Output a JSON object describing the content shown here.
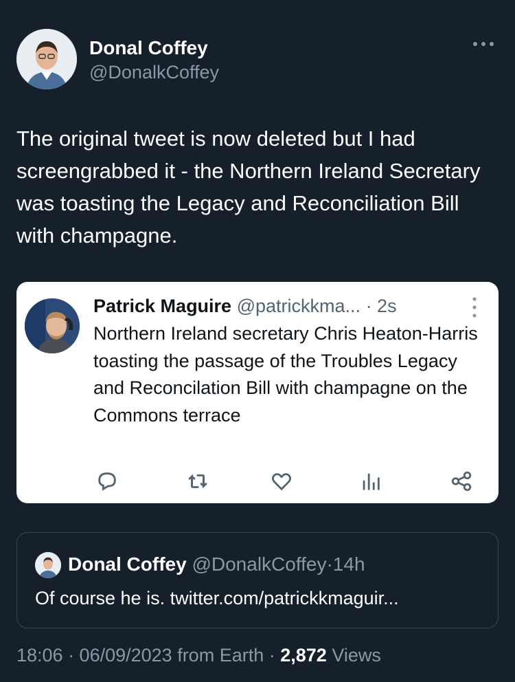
{
  "author": {
    "name": "Donal Coffey",
    "handle": "@DonalkCoffey"
  },
  "tweet": {
    "text": "The original tweet is now deleted but I had screengrabbed it - the Northern Ireland Secretary was toasting the Legacy and Reconciliation Bill with champagne."
  },
  "embedded": {
    "name": "Patrick Maguire",
    "handle": "@patrickkma...",
    "time": "· 2s",
    "text": "Northern Ireland secretary Chris Heaton-Harris toasting the passage of the Troubles Legacy and Reconcilation Bill with champagne on the Commons terrace",
    "actions": [
      "reply-icon",
      "retweet-icon",
      "like-icon",
      "views-icon",
      "share-icon"
    ]
  },
  "quote": {
    "name": "Donal Coffey",
    "handle": "@DonalkCoffey",
    "time": "·14h",
    "text": "Of course he is. twitter.com/patrickkmaguir..."
  },
  "meta": {
    "timestamp": "18:06 · 06/09/2023 from Earth ·",
    "views_count": "2,872",
    "views_label": "Views"
  },
  "colors": {
    "background": "#15202b",
    "secondary_text": "#8b98a5",
    "card_bg": "#ffffff"
  }
}
